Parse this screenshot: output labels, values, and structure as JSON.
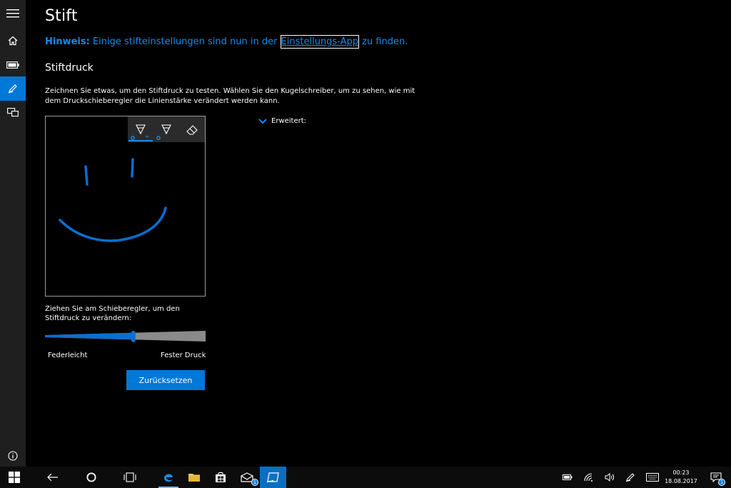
{
  "page": {
    "title": "Stift",
    "hint_prefix": "Hinweis:",
    "hint_text_before": " Einige stifteinstellungen sind nun in der ",
    "hint_link": "Einstellungs-App",
    "hint_text_after": " zu finden.",
    "section_title": "Stiftdruck",
    "description": "Zeichnen Sie etwas, um den Stiftdruck zu testen. Wählen Sie den Kugelschreiber, um zu sehen, wie mit dem Druckschieberegler die Linienstärke verändert werden kann.",
    "slider_label": "Ziehen Sie am Schieberegler, um den Stiftdruck zu verändern:",
    "slider_min_label": "Federleicht",
    "slider_max_label": "Fester Druck",
    "slider_value": 0.55,
    "reset_label": "Zurücksetzen",
    "advanced_label": "Erweitert:"
  },
  "nav": {
    "items": [
      {
        "icon": "hamburger-menu-icon"
      },
      {
        "icon": "home-icon"
      },
      {
        "icon": "battery-icon"
      },
      {
        "icon": "pen-icon",
        "active": true
      },
      {
        "icon": "devices-icon"
      }
    ],
    "footer_icon": "info-icon"
  },
  "toolbar": {
    "tools": [
      "ballpoint-pen-icon",
      "pencil-icon",
      "eraser-icon"
    ],
    "active": "ballpoint-pen-icon"
  },
  "taskbar": {
    "items": [
      "windows-start-icon",
      "back-arrow-icon",
      "cortana-icon",
      "task-view-icon",
      "edge-icon",
      "file-explorer-icon",
      "store-icon",
      "mail-icon",
      "pen-app-icon"
    ],
    "mail_badge": "1",
    "tray": [
      "battery-icon",
      "network-icon",
      "volume-icon",
      "pen-icon",
      "keyboard-icon"
    ],
    "time": "00:23",
    "date": "18.08.2017",
    "notification_badge": "1"
  },
  "colors": {
    "accent": "#0078d7",
    "link": "#1b8ae6",
    "rail": "#1f1f1f",
    "taskbar": "#0c0c0c",
    "ink": "#0a6fd0"
  }
}
